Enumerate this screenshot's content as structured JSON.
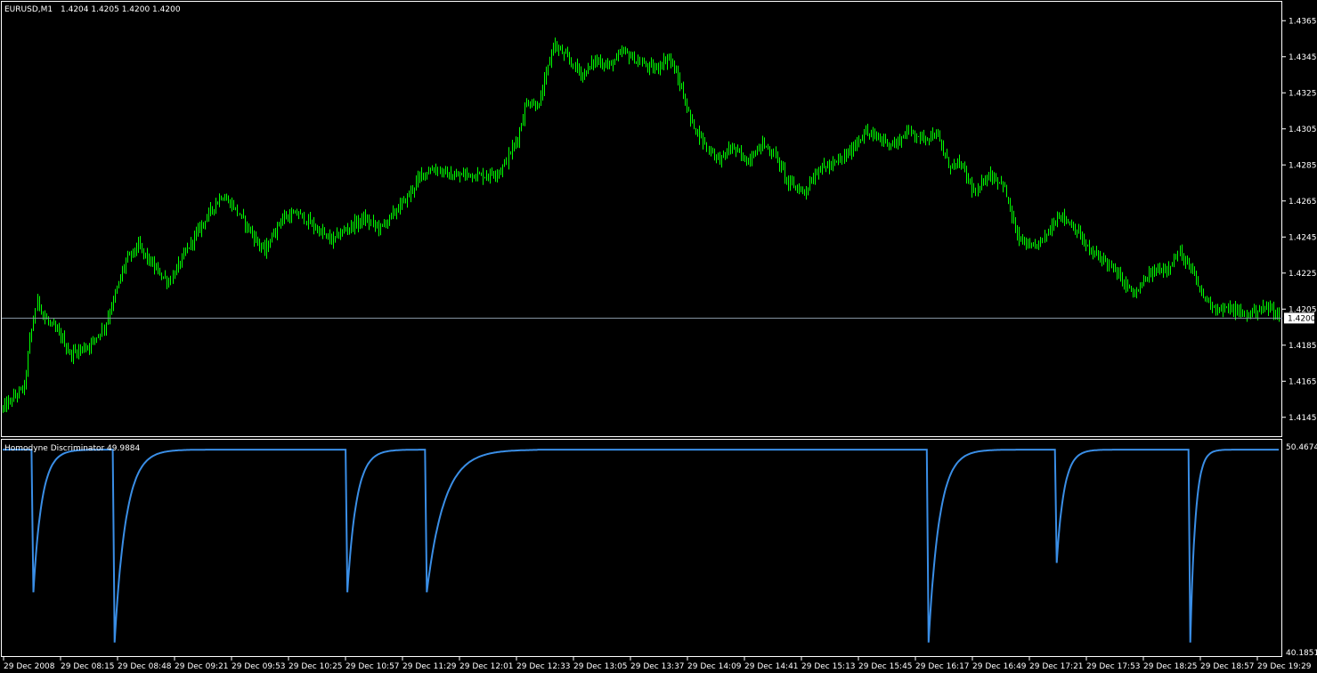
{
  "header": {
    "symbol_label": "EURUSD,M1",
    "ohlc_label": "1.4204 1.4205 1.4200 1.4200"
  },
  "indicator": {
    "label": "Homodyne Discriminator 49.9884",
    "max_label": "50.4674",
    "min_label": "40.1851"
  },
  "colors": {
    "background": "#000000",
    "frame": "#ffffff",
    "candles": "#00ff00",
    "indicator_line": "#3a8ee6",
    "price_line": "#8a9aa8",
    "price_tag_bg": "#ffffff",
    "price_tag_text": "#000000"
  },
  "chart_data": [
    {
      "type": "line",
      "name": "main",
      "title": "EURUSD,M1",
      "ylim": [
        1.4135,
        1.4375
      ],
      "yticks": [
        "1.4365",
        "1.4345",
        "1.4325",
        "1.4305",
        "1.4285",
        "1.4265",
        "1.4245",
        "1.4225",
        "1.4205",
        "1.4185",
        "1.4165",
        "1.4145"
      ],
      "current_price": "1.4200",
      "xticks": [
        "29 Dec 2008",
        "29 Dec 08:15",
        "29 Dec 08:48",
        "29 Dec 09:21",
        "29 Dec 09:53",
        "29 Dec 10:25",
        "29 Dec 10:57",
        "29 Dec 11:29",
        "29 Dec 12:01",
        "29 Dec 12:33",
        "29 Dec 13:05",
        "29 Dec 13:37",
        "29 Dec 14:09",
        "29 Dec 14:41",
        "29 Dec 15:13",
        "29 Dec 15:45",
        "29 Dec 16:17",
        "29 Dec 16:49",
        "29 Dec 17:21",
        "29 Dec 17:53",
        "29 Dec 18:25",
        "29 Dec 18:57",
        "29 Dec 19:29"
      ],
      "x": [
        "07:44",
        "07:56",
        "07:59",
        "08:03",
        "08:07",
        "08:16",
        "08:21",
        "08:32",
        "08:40",
        "08:45",
        "08:52",
        "08:59",
        "09:08",
        "09:16",
        "09:27",
        "09:36",
        "09:45",
        "09:52",
        "10:03",
        "10:09",
        "10:18",
        "10:28",
        "10:37",
        "10:46",
        "10:55",
        "11:04",
        "11:13",
        "11:22",
        "11:28",
        "11:36",
        "11:44",
        "11:53",
        "12:01",
        "12:11",
        "12:20",
        "12:29",
        "12:34",
        "12:41",
        "12:49",
        "12:56",
        "13:05",
        "13:12",
        "13:20",
        "13:28",
        "13:36",
        "13:45",
        "13:53",
        "13:59",
        "14:05",
        "14:14",
        "14:21",
        "14:28",
        "14:36",
        "14:45",
        "14:52",
        "14:59",
        "15:08",
        "15:16",
        "15:24",
        "15:33",
        "15:41",
        "15:49",
        "15:58",
        "16:06",
        "16:13",
        "16:21",
        "16:28",
        "16:35",
        "16:43",
        "16:49",
        "16:58",
        "17:06",
        "17:14",
        "17:21",
        "17:29",
        "17:38",
        "17:46",
        "17:54",
        "18:03",
        "18:11",
        "18:20",
        "18:29",
        "18:36",
        "18:43",
        "18:49",
        "18:57",
        "19:04",
        "19:12",
        "19:20",
        "19:27",
        "19:31"
      ],
      "series": [
        {
          "values": [
            1.415,
            1.4162,
            1.4188,
            1.421,
            1.42,
            1.419,
            1.418,
            1.4185,
            1.4195,
            1.421,
            1.4232,
            1.424,
            1.4228,
            1.422,
            1.424,
            1.4255,
            1.4268,
            1.4262,
            1.4245,
            1.4237,
            1.4255,
            1.4258,
            1.425,
            1.4243,
            1.425,
            1.4255,
            1.425,
            1.426,
            1.4267,
            1.428,
            1.4283,
            1.4278,
            1.428,
            1.4279,
            1.4282,
            1.43,
            1.432,
            1.4318,
            1.4352,
            1.4345,
            1.4335,
            1.4343,
            1.434,
            1.4348,
            1.4342,
            1.4338,
            1.4345,
            1.433,
            1.431,
            1.4295,
            1.4288,
            1.4295,
            1.4287,
            1.4297,
            1.429,
            1.4275,
            1.427,
            1.4283,
            1.4285,
            1.4292,
            1.4303,
            1.43,
            1.4296,
            1.4304,
            1.43,
            1.4302,
            1.4285,
            1.4285,
            1.4268,
            1.428,
            1.4275,
            1.4245,
            1.4238,
            1.4245,
            1.4258,
            1.425,
            1.4237,
            1.4233,
            1.4222,
            1.4213,
            1.4225,
            1.4228,
            1.4236,
            1.4225,
            1.4212,
            1.4205,
            1.4205,
            1.4202,
            1.4205,
            1.4206,
            1.42
          ]
        }
      ]
    },
    {
      "type": "line",
      "name": "Homodyne Discriminator",
      "ylim": [
        40.1851,
        50.4674
      ],
      "dips": [
        {
          "at": "08:01",
          "min": 43.16,
          "recover": "08:16"
        },
        {
          "at": "08:46",
          "min": 40.68,
          "recover": "09:06"
        },
        {
          "at": "10:55",
          "min": 43.16,
          "recover": "11:11"
        },
        {
          "at": "11:39",
          "min": 43.16,
          "recover": "12:10"
        },
        {
          "at": "16:17",
          "min": 40.68,
          "recover": "16:36"
        },
        {
          "at": "17:28",
          "min": 44.61,
          "recover": "17:41"
        },
        {
          "at": "18:42",
          "min": 40.68,
          "recover": "18:51"
        }
      ],
      "plateau": 50.2,
      "start": "07:44",
      "end": "19:31"
    }
  ]
}
